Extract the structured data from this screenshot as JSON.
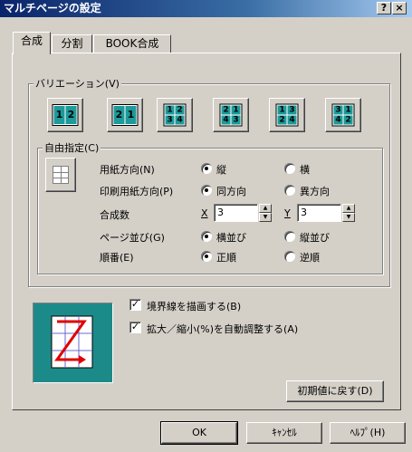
{
  "window": {
    "title": "マルチページの設定",
    "help_btn": "?",
    "close_btn": "×"
  },
  "tabs": [
    {
      "label": "合成"
    },
    {
      "label": "分割"
    },
    {
      "label": "BOOK合成"
    }
  ],
  "variation": {
    "legend": "バリエーション(V)",
    "layouts": [
      {
        "cells": [
          "1",
          "2"
        ]
      },
      {
        "cells": [
          "2",
          "1"
        ]
      },
      {
        "cells": [
          "1",
          "2",
          "3",
          "4"
        ]
      },
      {
        "cells": [
          "2",
          "1",
          "4",
          "3"
        ]
      },
      {
        "cells": [
          "1",
          "3",
          "2",
          "4"
        ]
      },
      {
        "cells": [
          "3",
          "1",
          "4",
          "2"
        ]
      }
    ],
    "custom": {
      "legend": "自由指定(C)",
      "rows": [
        {
          "label": "用紙方向(N)",
          "opt1": "縦",
          "opt2": "横",
          "selected": 1
        },
        {
          "label": "印刷用紙方向(P)",
          "opt1": "同方向",
          "opt2": "異方向",
          "selected": 1
        },
        {
          "label": "ページ並び(G)",
          "opt1": "横並び",
          "opt2": "縦並び",
          "selected": 1
        },
        {
          "label": "順番(E)",
          "opt1": "正順",
          "opt2": "逆順",
          "selected": 1
        }
      ],
      "combine": {
        "label": "合成数",
        "x_label": "X",
        "x_value": "3",
        "y_label": "Y",
        "y_value": "3"
      }
    }
  },
  "options": {
    "border": {
      "label": "境界線を描画する(B)",
      "checked": true
    },
    "autoscale": {
      "label": "拡大／縮小(%)を自動調整する(A)",
      "checked": true
    }
  },
  "reset_button": "初期値に戻す(D)",
  "footer": {
    "ok": "OK",
    "cancel": "ｷｬﾝｾﾙ",
    "help": "ﾍﾙﾌﾟ(H)"
  },
  "colors": {
    "title_start": "#0a246a",
    "accent_teal": "#1d8a8a"
  }
}
